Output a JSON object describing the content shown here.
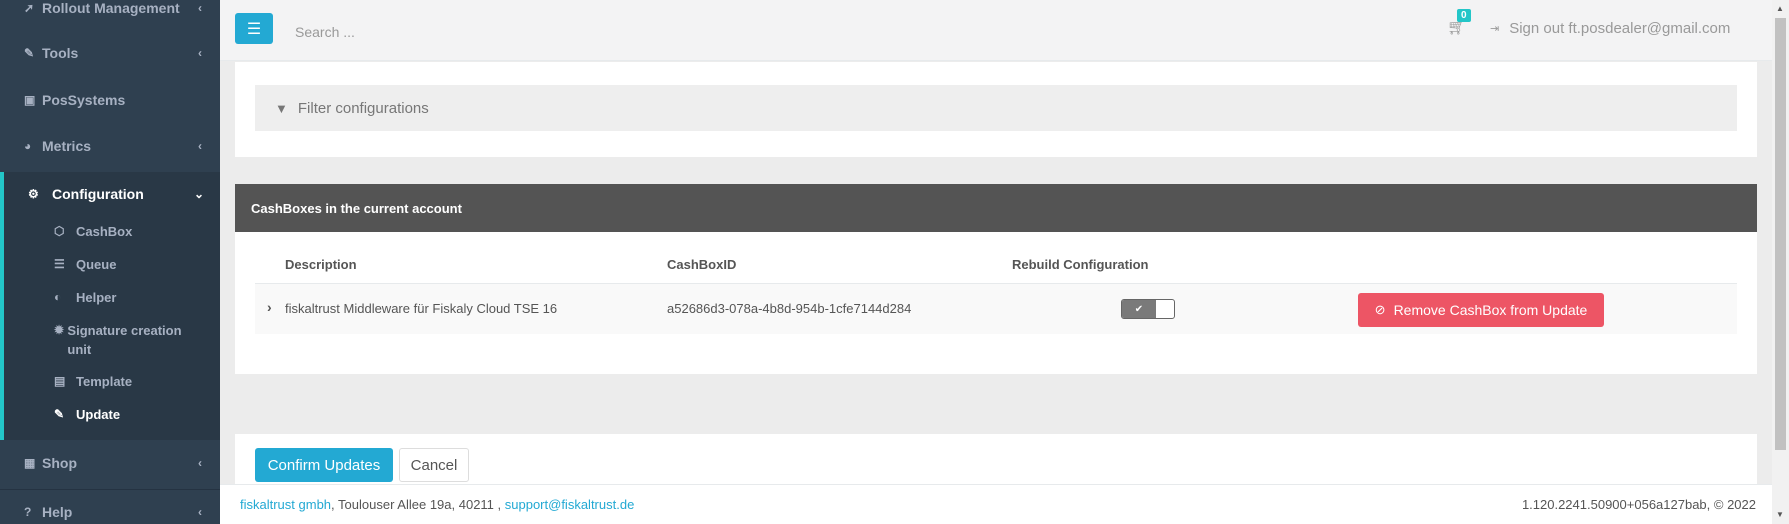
{
  "sidebar": {
    "items": [
      {
        "label": "Rollout Management",
        "icon": "rocket-icon"
      },
      {
        "label": "Tools",
        "icon": "wrench-icon"
      },
      {
        "label": "PosSystems",
        "icon": "briefcase-icon"
      },
      {
        "label": "Metrics",
        "icon": "pie-chart-icon"
      },
      {
        "label": "Configuration",
        "icon": "cogs-icon"
      },
      {
        "label": "Shop",
        "icon": "basket-icon"
      },
      {
        "label": "Help",
        "icon": "question-icon"
      }
    ],
    "config_subitems": [
      {
        "label": "CashBox",
        "icon": "cube-icon"
      },
      {
        "label": "Queue",
        "icon": "database-icon"
      },
      {
        "label": "Helper",
        "icon": "half-circle-icon"
      },
      {
        "label": "Signature creation unit",
        "icon": "certificate-icon"
      },
      {
        "label": "Template",
        "icon": "file-icon"
      },
      {
        "label": "Update",
        "icon": "wrench-icon"
      }
    ]
  },
  "topbar": {
    "search_placeholder": "Search ...",
    "cart_count": "0",
    "signout_label": "Sign out ft.posdealer@gmail.com"
  },
  "filter": {
    "placeholder": "Filter configurations"
  },
  "cashboxes": {
    "title": "CashBoxes in the current account",
    "columns": [
      "Description",
      "CashBoxID",
      "Rebuild Configuration"
    ],
    "rows": [
      {
        "description": "fiskaltrust Middleware für Fiskaly Cloud TSE 16",
        "cashbox_id": "a52686d3-078a-4b8d-954b-1cfe7144d284",
        "rebuild": true,
        "action_label": "Remove CashBox from Update"
      }
    ]
  },
  "actions": {
    "confirm_label": "Confirm Updates",
    "cancel_label": "Cancel"
  },
  "footer": {
    "company": "fiskaltrust gmbh",
    "address": ", Toulouser Allee 19a, 40211 , ",
    "email": "support@fiskaltrust.de",
    "version": "1.120.2241.50900+056a127bab, © 2022"
  },
  "colors": {
    "sidebar_bg": "#2f4050",
    "primary": "#23a9d3",
    "danger": "#ed5565",
    "panel_header": "#545454",
    "accent": "#23c6c8"
  }
}
